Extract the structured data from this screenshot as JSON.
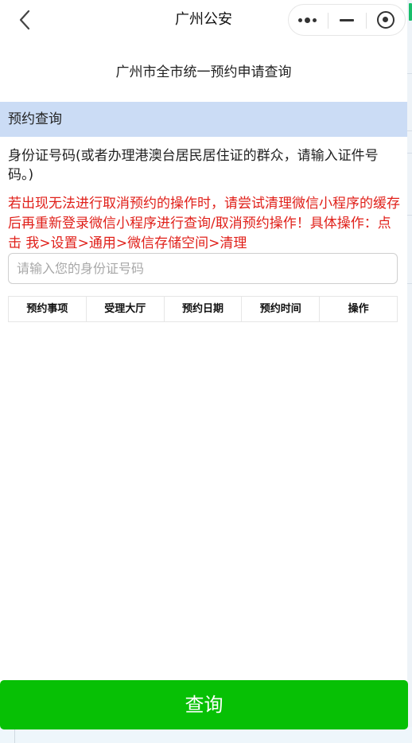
{
  "navbar": {
    "title": "广州公安",
    "back_icon": "chevron-left-icon",
    "capsule": {
      "more_icon": "more-dots-icon",
      "minimize_icon": "minimize-icon",
      "close_icon": "target-circle-icon"
    }
  },
  "page": {
    "heading": "广州市全市统一预约申请查询"
  },
  "section": {
    "title": "预约查询"
  },
  "form": {
    "id_label": "身份证号码(或者办理港澳台居民居住证的群众，请输入证件号码。)",
    "notice": "若出现无法进行取消预约的操作时，请尝试清理微信小程序的缓存后再重新登录微信小程序进行查询/取消预约操作！具体操作：点击 我>设置>通用>微信存储空间>清理",
    "id_input": {
      "value": "",
      "placeholder": "请输入您的身份证号码"
    }
  },
  "table": {
    "columns": [
      "预约事项",
      "受理大厅",
      "预约日期",
      "预约时间",
      "操作"
    ],
    "rows": []
  },
  "actions": {
    "query_label": "查询"
  },
  "colors": {
    "section_bg": "#cbdcf5",
    "notice_text": "#e0201a",
    "primary_button": "#07c005"
  }
}
